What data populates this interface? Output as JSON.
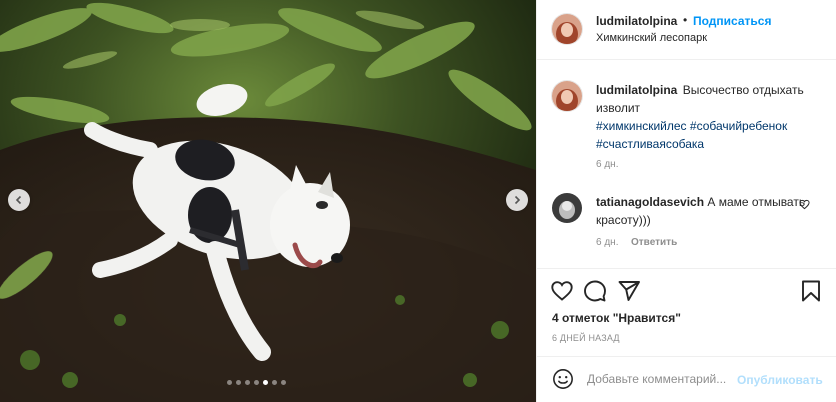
{
  "post": {
    "username": "ludmilatolpina",
    "separator": "•",
    "follow_label": "Подписаться",
    "location": "Химкинский лесопарк"
  },
  "caption": {
    "username": "ludmilatolpina",
    "text": "Высочество отдыхать изволит",
    "hashtags": [
      "#химкинскийлес",
      "#собачийребенок",
      "#счастливаясобака"
    ],
    "time": "6 дн."
  },
  "comment": {
    "username": "tatianagoldasevich",
    "text": "А маме отмывать красоту)))",
    "time": "6 дн.",
    "reply_label": "Ответить"
  },
  "stats": {
    "likes": "4 отметок \"Нравится\"",
    "posted_ago": "6 ДНЕЙ НАЗАД"
  },
  "composer": {
    "placeholder": "Добавьте комментарий...",
    "publish_label": "Опубликовать"
  },
  "carousel": {
    "total": 7,
    "active": 4
  },
  "icons": {
    "prev": "chevron-left-icon",
    "next": "chevron-right-icon",
    "like": "heart-icon",
    "comment": "comment-icon",
    "share": "paper-plane-icon",
    "save": "bookmark-icon",
    "emoji": "smiley-icon"
  },
  "colors": {
    "accent": "#0095f6",
    "link": "#00376b",
    "muted": "#8e8e8e",
    "publish_disabled": "#b2dffc"
  }
}
